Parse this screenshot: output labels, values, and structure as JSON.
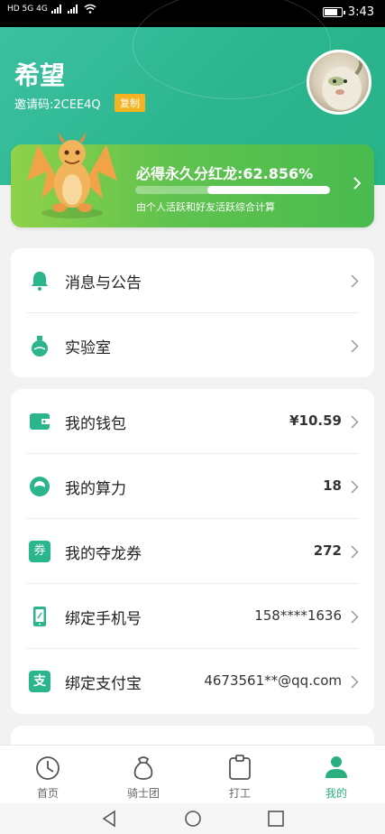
{
  "status_bar": {
    "time": "3:43",
    "network_left": "HD 5G 4G"
  },
  "profile": {
    "name": "希望",
    "invite_code": "邀请码:2CEE4Q",
    "copy_label": "复制"
  },
  "dragon": {
    "title": "必得永久分红龙:62.856%",
    "progress": 0.63,
    "subtitle": "由个人活跃和好友活跃综合计算"
  },
  "menu_top": [
    {
      "label": "消息与公告",
      "icon": "bell-icon"
    },
    {
      "label": "实验室",
      "icon": "flask-icon"
    }
  ],
  "menu_account": [
    {
      "label": "我的钱包",
      "value": "¥10.59",
      "icon": "wallet-icon",
      "bold": true
    },
    {
      "label": "我的算力",
      "value": "18",
      "icon": "power-icon",
      "bold": true
    },
    {
      "label": "我的夺龙券",
      "value": "272",
      "icon": "coupon-icon",
      "bold": true
    },
    {
      "label": "绑定手机号",
      "value": "158****1636",
      "icon": "phone-icon",
      "bold": false
    },
    {
      "label": "绑定支付宝",
      "value": "4673561**@qq.com",
      "icon": "alipay-icon",
      "bold": false
    }
  ],
  "coupon_icon_text": "券",
  "alipay_icon_text": "支",
  "tabs": [
    {
      "label": "首页",
      "icon": "home-icon"
    },
    {
      "label": "骑士团",
      "icon": "bag-icon"
    },
    {
      "label": "打工",
      "icon": "clipboard-icon"
    },
    {
      "label": "我的",
      "icon": "user-icon",
      "active": true
    }
  ],
  "colors": {
    "primary": "#2ab58d",
    "accent": "#f5b321",
    "active_tab": "#2ab07e"
  }
}
